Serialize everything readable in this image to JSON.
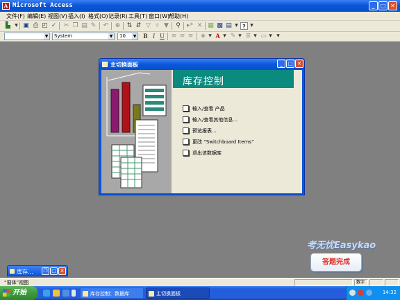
{
  "window": {
    "title": "Microsoft Access",
    "app_icon": "access-key-icon"
  },
  "menubar": {
    "items": [
      {
        "label": "文件(F)"
      },
      {
        "label": "编辑(E)"
      },
      {
        "label": "视图(V)"
      },
      {
        "label": "插入(I)"
      },
      {
        "label": "格式(O)"
      },
      {
        "label": "记录(R)"
      },
      {
        "label": "工具(T)"
      },
      {
        "label": "窗口(W)"
      },
      {
        "label": "帮助(H)"
      }
    ]
  },
  "format_toolbar": {
    "object_value": "",
    "font_value": "System",
    "size_value": "10",
    "bold": "B",
    "italic": "I",
    "underline": "U"
  },
  "switchboard": {
    "title": "主切换面板",
    "header": "库存控制",
    "items": [
      {
        "label": "输入/查看 产品"
      },
      {
        "label": "输入/查看其他信息..."
      },
      {
        "label": "预览报表..."
      },
      {
        "label": "更改 “Switchboard Items”"
      },
      {
        "label": "退出该数据库"
      }
    ]
  },
  "minimized_window": {
    "title": "库存..."
  },
  "watermark": "考无忧Easykao",
  "done_button": "答题完成",
  "statusbar": {
    "text": "“窗体”视图",
    "cell_right": "数字"
  },
  "taskbar": {
    "start_label": "开始",
    "tasks": [
      {
        "label": "库存控制：数据库"
      },
      {
        "label": "主切换面板"
      }
    ],
    "clock": "14:32"
  },
  "colors": {
    "title_blue": "#0a57d8",
    "header_teal": "#0b8a7f",
    "workspace": "#808080",
    "done_text": "#e0342b"
  }
}
